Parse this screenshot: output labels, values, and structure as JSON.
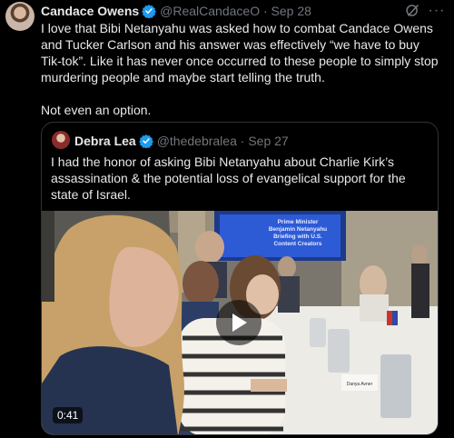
{
  "tweet": {
    "author_name": "Candace Owens",
    "handle": "@RealCandaceO",
    "separator": "·",
    "date": "Sep 28",
    "text": "I love that Bibi Netanyahu was asked how to combat Candace Owens and Tucker Carlson and his answer was effectively “we have to buy Tik-tok”. Like it has never once occurred to these people to simply stop murdering people and maybe start telling the truth.\n\nNot even an option.",
    "more_icon": "more-horizontal-icon",
    "grok_icon": "grok-icon"
  },
  "quote": {
    "author_name": "Debra Lea",
    "handle": "@thedebralea",
    "separator": "·",
    "date": "Sep 27",
    "text": "I had the honor of asking Bibi Netanyahu about Charlie Kirk’s assassination & the potential loss of evangelical support for the state of Israel."
  },
  "video": {
    "duration": "0:41",
    "screen_text": "Prime Minister\nBenjamin Netanyahu\nBriefing with U.S.\nContent Creators",
    "place_card": "Danya Avner",
    "play_icon": "play-icon"
  },
  "colors": {
    "background": "#000000",
    "text": "#e7e9ea",
    "muted": "#71767b",
    "verified": "#1d9bf0",
    "border": "#2f3336"
  }
}
